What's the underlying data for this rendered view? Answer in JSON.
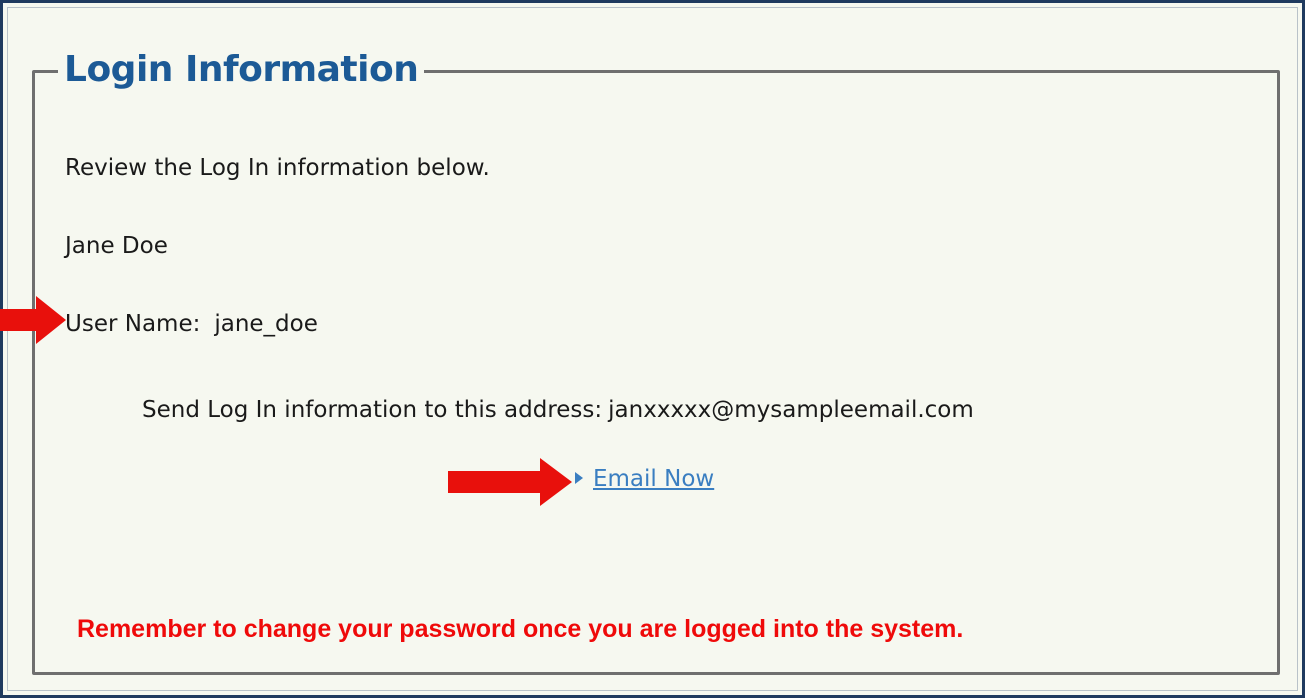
{
  "section": {
    "title": "Login Information"
  },
  "content": {
    "intro": "Review the Log In information below.",
    "full_name": "Jane Doe",
    "username_label": "User Name:",
    "username_value": "jane_doe",
    "send_info_label": "Send Log In information to this address:",
    "email_address": "janxxxxx@mysampleemail.com",
    "email_link_label": "Email Now",
    "warning": "Remember to change your password once you are logged into the system."
  },
  "colors": {
    "title": "#1c5a96",
    "link": "#3a7ec1",
    "warning": "#ef0a0a",
    "arrow": "#e8100c",
    "frame_border": "#1f3a5f",
    "background": "#f6f8f0"
  },
  "icons": {
    "link_caret": "caret-right-icon",
    "callout_arrow": "arrow-right-icon"
  }
}
